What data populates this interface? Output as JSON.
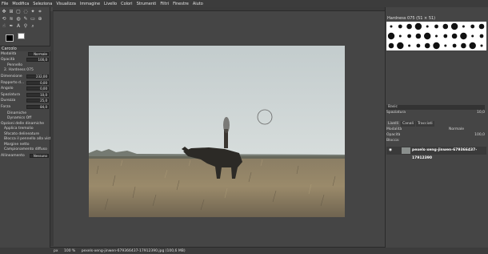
{
  "menubar": [
    "File",
    "Modifica",
    "Seleziona",
    "Visualizza",
    "Immagine",
    "Livello",
    "Colori",
    "Strumenti",
    "Filtri",
    "Finestre",
    "Aiuto"
  ],
  "tool_options": {
    "title": "Carcolo",
    "mode_label": "Modalità",
    "mode_value": "Normale",
    "opacity_label": "Opacità",
    "opacity_value": "100,0",
    "brush_label": "Pennello",
    "brush_value": "2. Hardness 075",
    "params": [
      {
        "label": "Dimensione",
        "value": "232,00"
      },
      {
        "label": "Rapporto d...",
        "value": "0,00"
      },
      {
        "label": "Angolo",
        "value": "0,00"
      },
      {
        "label": "Spaziatura",
        "value": "10,0"
      },
      {
        "label": "Durezza",
        "value": "25,0"
      },
      {
        "label": "Forza",
        "value": "84,0"
      }
    ],
    "dynamics_label": "Dinamiche",
    "dynamics_value": "Dynamics Off",
    "options_header": "Opzioni delle dinamiche",
    "checks": [
      "Applica tremolio",
      "Sfocato delineature",
      "Blocca il pennello alla vista",
      "Margine netto",
      "Campionamento diffuso"
    ],
    "align_label": "Allineamento",
    "align_value": "Nessuno"
  },
  "brushes": {
    "header": "Hardness 075 (51 × 51)",
    "basic": "Basic",
    "spacing_label": "Spaziatura",
    "spacing_value": "10,0"
  },
  "layers": {
    "tabs": [
      "Livelli",
      "Canali",
      "Tracciati"
    ],
    "mode_label": "Modalità",
    "mode_value": "Normale",
    "opacity_label": "Opacità",
    "opacity_value": "100,0",
    "lock_label": "Blocca:",
    "layer_name": "pexels-xeng-jinwen-679366437-17912390"
  },
  "statusbar": {
    "unit": "px",
    "zoom": "100 %",
    "file": "pexels-xeng-jinwen-679366437-17912390.jpg (100,6 MB)"
  }
}
